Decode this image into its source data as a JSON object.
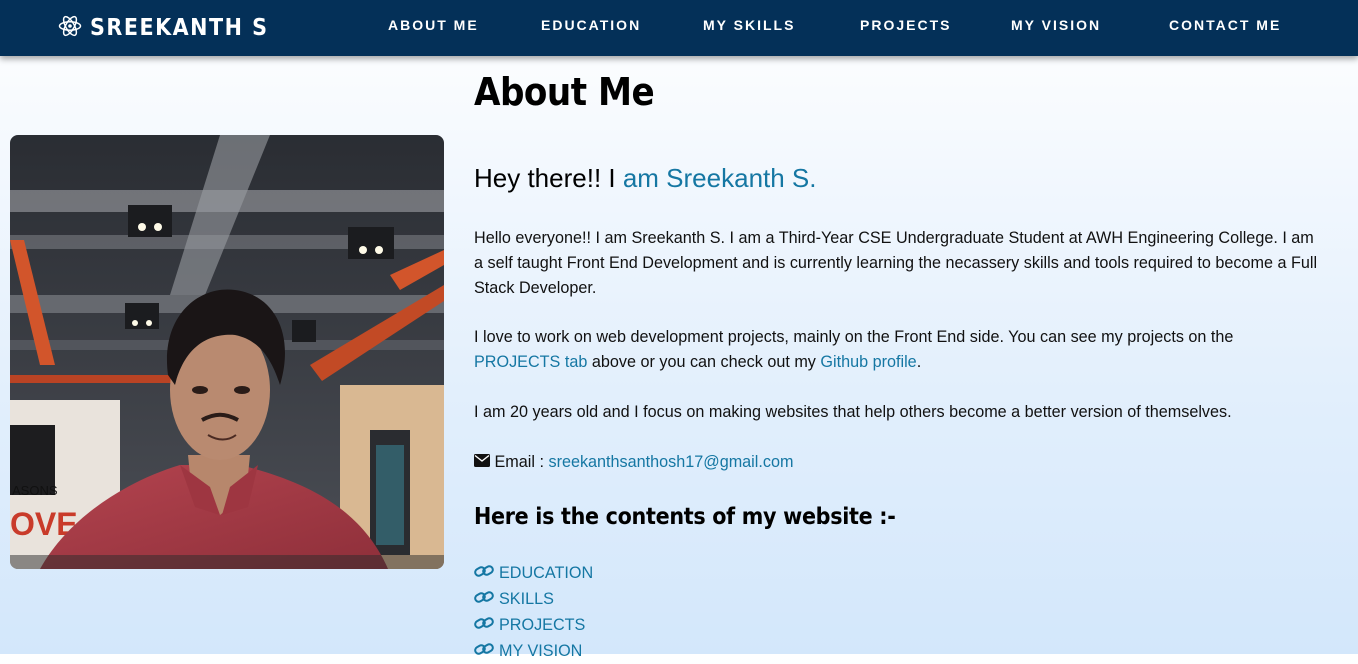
{
  "brand": {
    "name": "SREEKANTH S",
    "icon": "atom-icon"
  },
  "nav": {
    "items": [
      {
        "label": "ABOUT ME"
      },
      {
        "label": "EDUCATION"
      },
      {
        "label": "MY SKILLS"
      },
      {
        "label": "PROJECTS"
      },
      {
        "label": "MY VISION"
      },
      {
        "label": "CONTACT ME"
      }
    ]
  },
  "about": {
    "title": "About Me",
    "greeting_prefix": "Hey there!! I ",
    "greeting_name": "am Sreekanth S.",
    "para1": "Hello everyone!! I am Sreekanth S. I am a Third-Year CSE Undergraduate Student at AWH Engineering College. I am a self taught Front End Development and is currently learning the necassery skills and tools required to become a Full Stack Developer.",
    "para2_start": "I love to work on web development projects, mainly on the Front End side. You can see my projects on the ",
    "para2_link1": "PROJECTS tab",
    "para2_mid": " above or you can check out my ",
    "para2_link2": "Github profile",
    "para2_end": ".",
    "para3": "I am 20 years old and I focus on making websites that help others become a better version of themselves.",
    "email_label": " Email : ",
    "email_value": "sreekanthsanthosh17@gmail.com",
    "email_icon": "envelope-icon"
  },
  "contents": {
    "heading": "Here is the contents of my website :-",
    "link_icon": "link-icon",
    "items": [
      "EDUCATION",
      "SKILLS",
      "PROJECTS",
      "MY VISION"
    ]
  },
  "colors": {
    "navbar": "#043058",
    "accent": "#1577a3"
  }
}
